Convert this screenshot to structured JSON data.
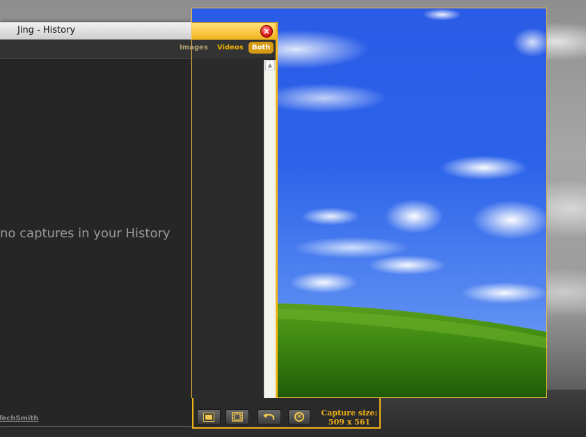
{
  "history_window": {
    "title": "Jing - History",
    "empty_message": "no captures in your History",
    "footer_link": "TechSmith"
  },
  "capture_panel": {
    "tabs": [
      {
        "label": "Images",
        "selected": false
      },
      {
        "label": "Videos",
        "selected": false
      },
      {
        "label": "Both",
        "selected": true
      }
    ],
    "close_icon": "close-icon",
    "accent_color": "#f2b319"
  },
  "capture_toolbar": {
    "buttons": [
      {
        "name": "capture-image",
        "icon": "image-icon"
      },
      {
        "name": "capture-video",
        "icon": "film-icon"
      },
      {
        "name": "redo-selection",
        "icon": "undo-arrow-icon"
      },
      {
        "name": "cancel",
        "icon": "cancel-icon"
      }
    ],
    "size_label": "Capture size:",
    "size_value": "509 x 561"
  }
}
